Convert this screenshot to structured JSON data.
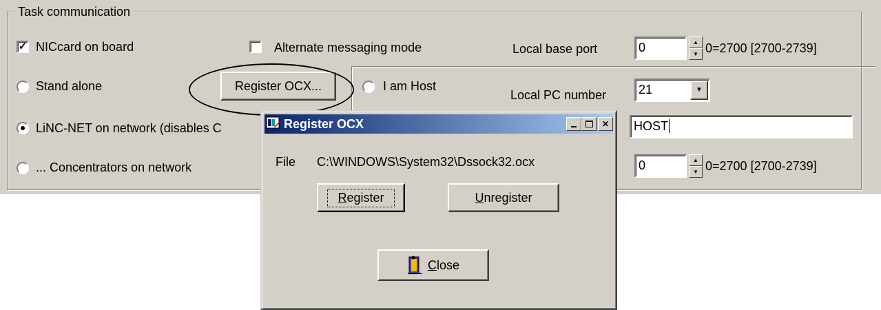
{
  "group": {
    "title": "Task communication",
    "nic_card": {
      "label": "NICcard on board",
      "checked": true
    },
    "alt_messaging": {
      "label": "Alternate messaging mode",
      "checked": false
    },
    "local_base_port": {
      "label": "Local base port",
      "value": "0",
      "hint": "0=2700 [2700-2739]"
    },
    "stand_alone": {
      "label": "Stand alone"
    },
    "register_ocx_button": "Register OCX...",
    "i_am_host": {
      "label": "I am Host"
    },
    "local_pc_number": {
      "label": "Local PC number",
      "value": "21"
    },
    "linc_net": {
      "label": "LiNC-NET on network (disables C",
      "selected": true
    },
    "host_name_field": {
      "value": "HOST"
    },
    "concentrators": {
      "label": "... Concentrators on network"
    },
    "port2": {
      "value": "0",
      "hint": "0=2700 [2700-2739]"
    }
  },
  "dialog": {
    "title": "Register OCX",
    "file_label": "File",
    "file_path": "C:\\WINDOWS\\System32\\Dssock32.ocx",
    "register_button": {
      "mnemonic": "R",
      "rest": "egister"
    },
    "unregister_button": {
      "mnemonic": "U",
      "rest": "nregister"
    },
    "close_button": {
      "mnemonic": "C",
      "rest": "lose"
    }
  }
}
